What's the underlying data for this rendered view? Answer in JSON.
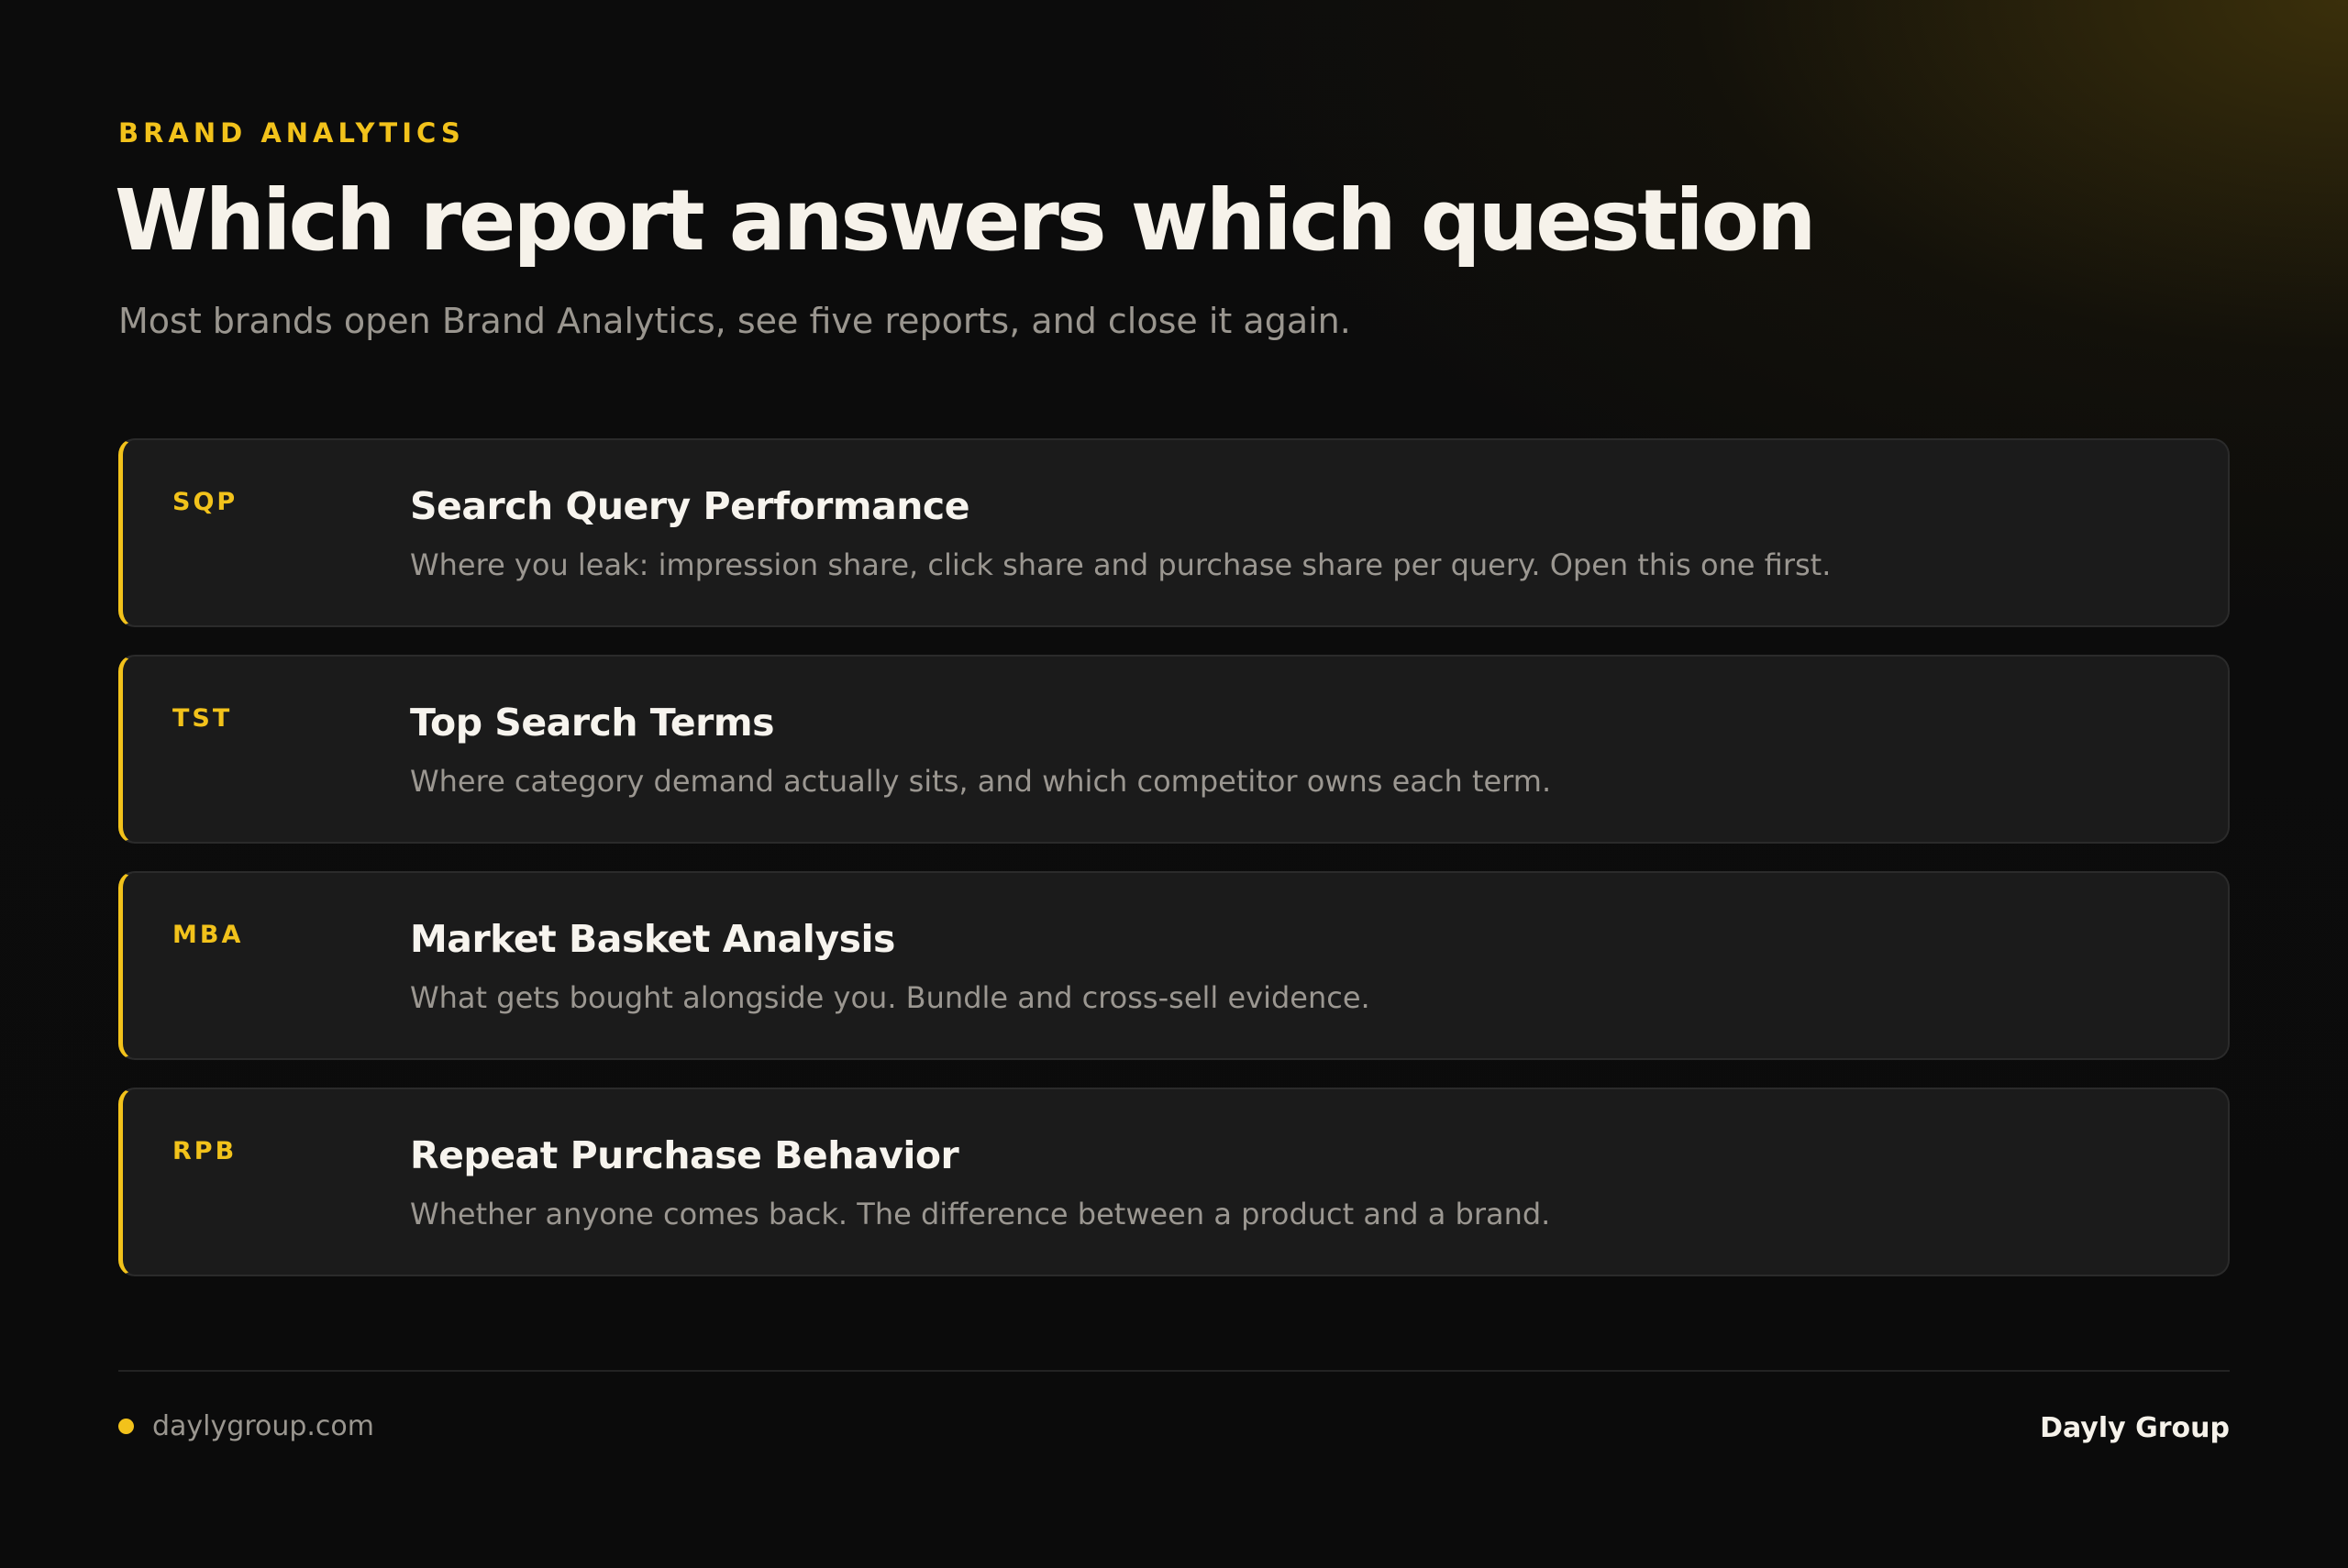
{
  "header": {
    "eyebrow": "BRAND ANALYTICS",
    "title": "Which report answers which question",
    "subtitle": "Most brands open Brand Analytics, see five reports, and close it again."
  },
  "reports": [
    {
      "code": "SQP",
      "title": "Search Query Performance",
      "description": "Where you leak: impression share, click share and purchase share per query. Open this one first."
    },
    {
      "code": "TST",
      "title": "Top Search Terms",
      "description": "Where category demand actually sits, and which competitor owns each term."
    },
    {
      "code": "MBA",
      "title": "Market Basket Analysis",
      "description": "What gets bought alongside you. Bundle and cross-sell evidence."
    },
    {
      "code": "RPB",
      "title": "Repeat Purchase Behavior",
      "description": "Whether anyone comes back. The difference between a product and a brand."
    }
  ],
  "footer": {
    "url": "daylygroup.com",
    "brand": "Dayly Group"
  },
  "colors": {
    "accent": "#f2c21b",
    "background": "#0b0b0b",
    "card": "#1b1b1b"
  }
}
